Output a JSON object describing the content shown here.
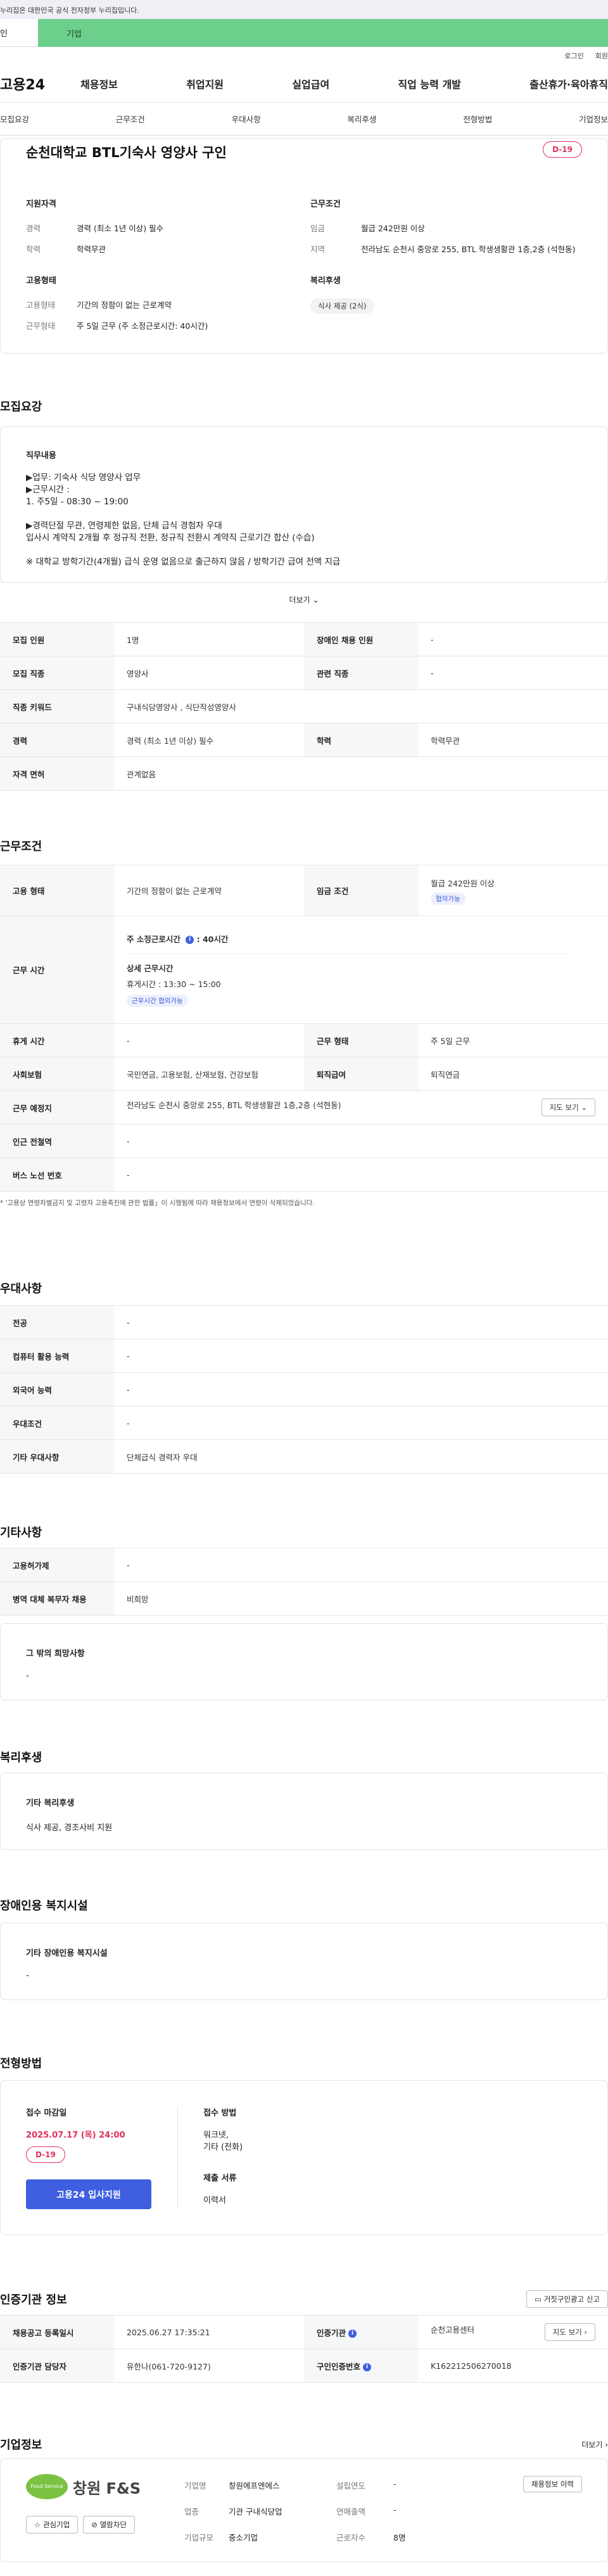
{
  "banner": {
    "text": "누리집은 대한민국 공식 전자정부 누리집입니다."
  },
  "usertype": {
    "personal": "인",
    "company": "기업"
  },
  "util": {
    "login": "로그인",
    "join": "회원"
  },
  "gnb": {
    "logo": "고용24",
    "menu": [
      "채용정보",
      "취업지원",
      "실업급여",
      "직업 능력 개발",
      "출산휴가·육아휴직"
    ]
  },
  "tabs": [
    "모집요강",
    "근무조건",
    "우대사항",
    "복리후생",
    "전형방법",
    "기업정보"
  ],
  "summary": {
    "title": "순천대학교 BTL기숙사 영양사 구인",
    "dday": "D-19",
    "qual": {
      "heading": "지원자격",
      "rows": [
        {
          "k": "경력",
          "v": "경력 (최소 1년 이상) 필수"
        },
        {
          "k": "학력",
          "v": "학력무관"
        }
      ]
    },
    "cond": {
      "heading": "근무조건",
      "rows": [
        {
          "k": "임금",
          "v": "월급 242만원 이상"
        },
        {
          "k": "지역",
          "v": "전라남도 순천시 중앙로 255, BTL 학생생활관 1층,2층 (석현동)"
        }
      ]
    },
    "emp": {
      "heading": "고용형태",
      "rows": [
        {
          "k": "고용형태",
          "v": "기간의 정함이 없는 근로계약"
        },
        {
          "k": "근무형태",
          "v": "주 5일 근무 (주 소정근로시간: 40시간)"
        }
      ]
    },
    "welfare": {
      "heading": "복리후생",
      "chip": "식사 제공 (2식)"
    }
  },
  "recruit": {
    "title": "모집요강",
    "desc_heading": "직무내용",
    "desc_lines": [
      "▶업무: 기숙사 식당 영양사 업무",
      "▶근무시간 :",
      "1. 주5일 - 08:30 ~ 19:00",
      "",
      "▶경력단절 무관, 연령제한 없음, 단체 급식 경험자 우대",
      "입사시 계약직 2개월 후 정규직 전환, 정규직 전환시 계약직 근로기간 합산 (수습)",
      "",
      "※ 대학교 방학기간(4개월) 급식 운영 없음으로 출근하지 않음 / 방학기간 급여 전액 지급"
    ],
    "more": "더보기",
    "table": {
      "r1": {
        "k1": "모집 인원",
        "v1": "1명",
        "k2": "장애인 채용 인원",
        "v2": "-"
      },
      "r2": {
        "k1": "모집 직종",
        "v1": "영양사",
        "k2": "관련 직종",
        "v2": "-"
      },
      "r3": {
        "k1": "직종 키워드",
        "v1": "구내식당영양사 , 식단작성영양사"
      },
      "r4": {
        "k1": "경력",
        "v1": "경력 (최소 1년 이상) 필수",
        "k2": "학력",
        "v2": "학력무관"
      },
      "r5": {
        "k1": "자격 면허",
        "v1": "관계없음"
      }
    }
  },
  "work": {
    "title": "근무조건",
    "emp_type_k": "고용 형태",
    "emp_type_v": "기간의 정함이 없는 근로계약",
    "wage_k": "임금 조건",
    "wage_v": "월급 242만원 이상",
    "wage_tag": "협의가능",
    "hours_k": "근무 시간",
    "hours_week": "주 소정근로시간",
    "hours_week_v": "40시간",
    "hours_detail_title": "상세 근무시간",
    "break_line": "휴게시간 :  13:30 ~ 15:00",
    "hours_tag": "근무시간 협의가능",
    "break_k": "휴게 시간",
    "break_v": "-",
    "shift_k": "근무 형태",
    "shift_v": "주 5일 근무",
    "ins_k": "사회보험",
    "ins_v": "국민연금, 고용보험, 산재보험, 건강보험",
    "ret_k": "퇴직급여",
    "ret_v": "퇴직연금",
    "place_k": "근무 예정지",
    "place_v": "전라남도 순천시 중앙로 255, BTL 학생생활관 1층,2층 (석현동)",
    "map_btn": "지도 보기",
    "station_k": "인근 전철역",
    "station_v": "-",
    "bus_k": "버스 노선 번호",
    "bus_v": "-",
    "note": "* '고용상 연령차별금지 및 고령자 고용촉진에 관한 법률」이 시행됨에 따라 채용정보에서 연령이 삭제되었습니다."
  },
  "pref": {
    "title": "우대사항",
    "rows": [
      {
        "k": "전공",
        "v": "-"
      },
      {
        "k": "컴퓨터 활용 능력",
        "v": "-"
      },
      {
        "k": "외국어 능력",
        "v": "-"
      },
      {
        "k": "우대조건",
        "v": "-"
      },
      {
        "k": "기타 우대사항",
        "v": "단체급식 경력자 우대"
      }
    ]
  },
  "etc": {
    "title": "기타사항",
    "rows": [
      {
        "k": "고용허가제",
        "v": "-"
      },
      {
        "k": "병역 대체 복무자 채용",
        "v": "비희망"
      }
    ],
    "other_title": "그 밖의 희망사항",
    "other_v": "-"
  },
  "benefit": {
    "title": "복리후생",
    "box_title": "기타 복리후생",
    "box_v": "식사 제공, 경조사비 지원"
  },
  "disabled": {
    "title": "장애인용 복지시설",
    "box_title": "기타 장애인용 복지시설",
    "box_v": "-"
  },
  "process": {
    "title": "전형방법",
    "deadline_k": "접수 마감일",
    "deadline_v": "2025.07.17 (목) 24:00",
    "dday": "D-19",
    "apply_btn": "고용24 입사지원",
    "method_k": "접수 방법",
    "method_v1": "워크넷,",
    "method_v2": "기타 (전화)",
    "docs_k": "제출 서류",
    "docs_v": "이력서"
  },
  "cert": {
    "title": "인증기관 정보",
    "report_btn": "거짓구인광고 신고",
    "r1k1": "채용공고 등록일시",
    "r1v1": "2025.06.27 17:35:21",
    "r1k2": "인증기관",
    "r1v2": "순천고용센터",
    "map_btn": "지도 보기",
    "r2k1": "인증기관 담당자",
    "r2v1": "유한나(061-720-9127)",
    "r2k2": "구인인증번호",
    "r2v2": "K162212506270018"
  },
  "company": {
    "title": "기업정보",
    "more": "더보기",
    "logo_text": "창원 F&S",
    "logo_sub": "Food Service",
    "fav_btn": "관심기업",
    "block_btn": "열람차단",
    "history_btn": "채용정보 이력",
    "c1": [
      {
        "k": "기업명",
        "v": "창원에프엔에스"
      },
      {
        "k": "업종",
        "v": "기관 구내식당업"
      },
      {
        "k": "기업규모",
        "v": "중소기업"
      }
    ],
    "c2": [
      {
        "k": "설립연도",
        "v": "-"
      },
      {
        "k": "연매출액",
        "v": "-"
      },
      {
        "k": "근로자수",
        "v": "8명"
      }
    ]
  }
}
